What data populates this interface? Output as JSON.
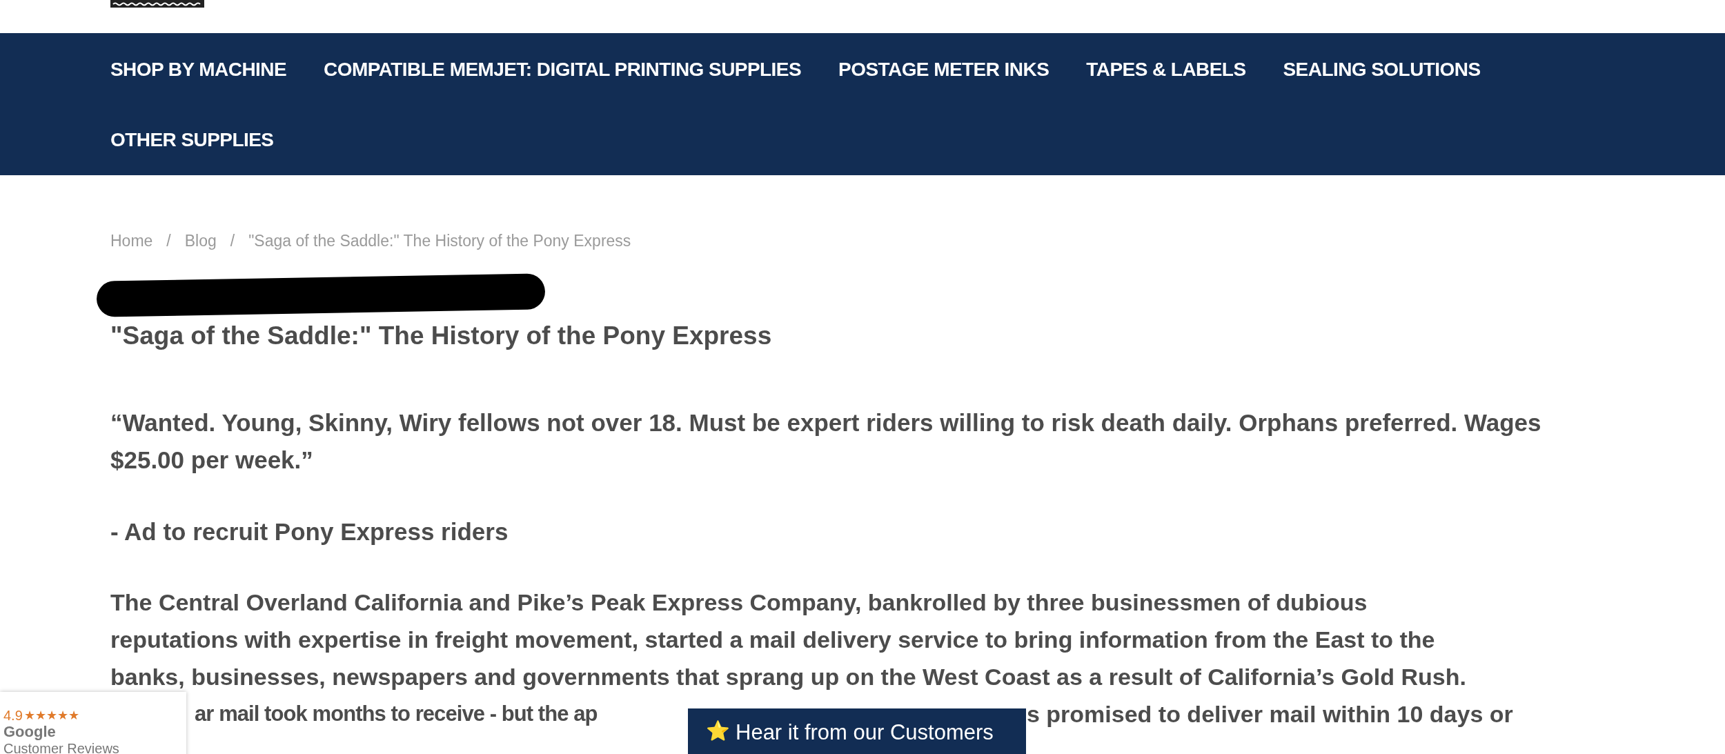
{
  "nav": {
    "items": [
      {
        "label": "SHOP BY MACHINE"
      },
      {
        "label": "COMPATIBLE MEMJET: DIGITAL PRINTING SUPPLIES"
      },
      {
        "label": "POSTAGE METER INKS"
      },
      {
        "label": "TAPES & LABELS"
      },
      {
        "label": "SEALING SOLUTIONS"
      },
      {
        "label": "OTHER SUPPLIES"
      }
    ]
  },
  "breadcrumb": [
    {
      "label": "Home"
    },
    {
      "separator": "/"
    },
    {
      "label": "Blog"
    },
    {
      "separator": "/"
    },
    {
      "label": "\"Saga of the Saddle:\" The History of the Pony Express"
    }
  ],
  "article": {
    "title": "\"Saga of the Saddle:\" The History of the Pony Express",
    "quote": "“Wanted. Young, Skinny, Wiry fellows not over 18. Must be expert riders willing to risk death daily. Orphans preferred. Wages $25.00 per week.”",
    "attribution": "- Ad to recruit Pony Express riders",
    "body_lines": [
      {
        "parts": [
          "The Central Overland California and Pike’s Peak Express Company, bankrolled by three businessmen of dubious"
        ]
      },
      {
        "parts": [
          "reputations with expertise in freight movement, started a mail delivery service to bring information from the East to the"
        ]
      },
      {
        "parts": [
          "banks, businesses, newspapers and governments that sprang up on the West Coast as a result of California’s Gold Rush."
        ]
      },
      {
        "parts": [
          "ar mail took months to receive - but the ap",
          "s promised to deliver mail within 10 days or"
        ]
      }
    ]
  },
  "reviews_badge": {
    "rating": "4.9",
    "stars": 5,
    "source": "Google",
    "caption": "Customer Reviews"
  },
  "reviews_button": {
    "icon": "⭐",
    "label": "Hear it from our Customers"
  }
}
